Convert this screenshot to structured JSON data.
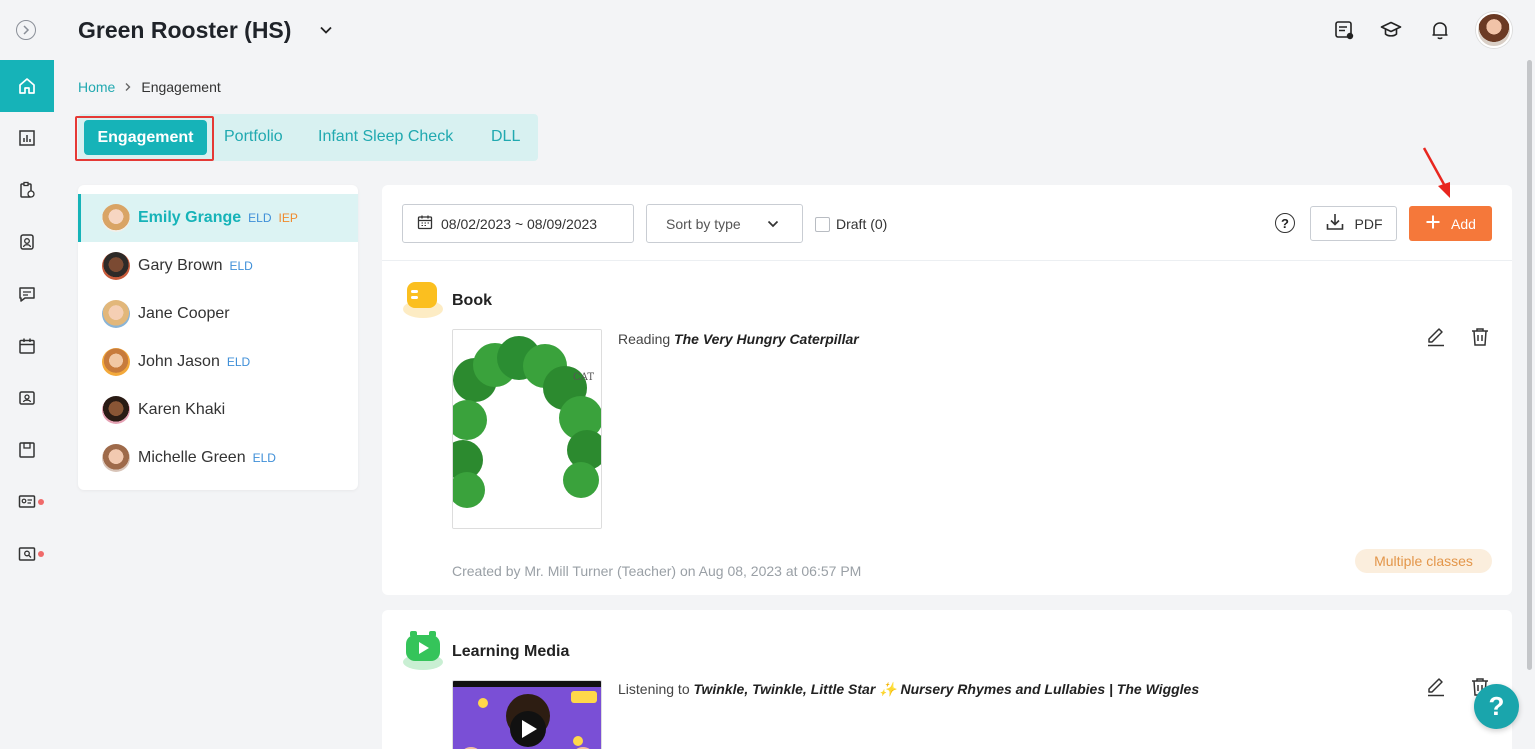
{
  "header": {
    "title": "Green Rooster (HS)"
  },
  "breadcrumb": {
    "home": "Home",
    "current": "Engagement"
  },
  "tabs": [
    {
      "label": "Engagement",
      "active": true
    },
    {
      "label": "Portfolio"
    },
    {
      "label": "Infant Sleep Check"
    },
    {
      "label": "DLL"
    }
  ],
  "students": [
    {
      "name": "Emily Grange",
      "tags": [
        "ELD",
        "IEP"
      ],
      "active": true
    },
    {
      "name": "Gary Brown",
      "tags": [
        "ELD"
      ]
    },
    {
      "name": "Jane Cooper",
      "tags": []
    },
    {
      "name": "John Jason",
      "tags": [
        "ELD"
      ]
    },
    {
      "name": "Karen Khaki",
      "tags": []
    },
    {
      "name": "Michelle Green",
      "tags": [
        "ELD"
      ]
    }
  ],
  "toolbar": {
    "date_range": "08/02/2023 ~ 08/09/2023",
    "sort_label": "Sort by type",
    "draft_label": "Draft (0)",
    "help": "?",
    "pdf_label": "PDF",
    "add_label": "Add"
  },
  "items": [
    {
      "type": "Book",
      "verb": "Reading",
      "title": "The Very Hungry Caterpillar",
      "created": "Created by Mr. Mill Turner (Teacher) on Aug 08, 2023 at 06:57 PM",
      "badge": "Multiple classes"
    },
    {
      "type": "Learning Media",
      "verb": "Listening to",
      "title": "Twinkle, Twinkle, Little Star ✨ Nursery Rhymes and Lullabies | The Wiggles"
    }
  ],
  "fab": "?",
  "colors": {
    "accent": "#16b3b8",
    "add_button": "#f5783a",
    "highlight_outline": "#e53935"
  }
}
